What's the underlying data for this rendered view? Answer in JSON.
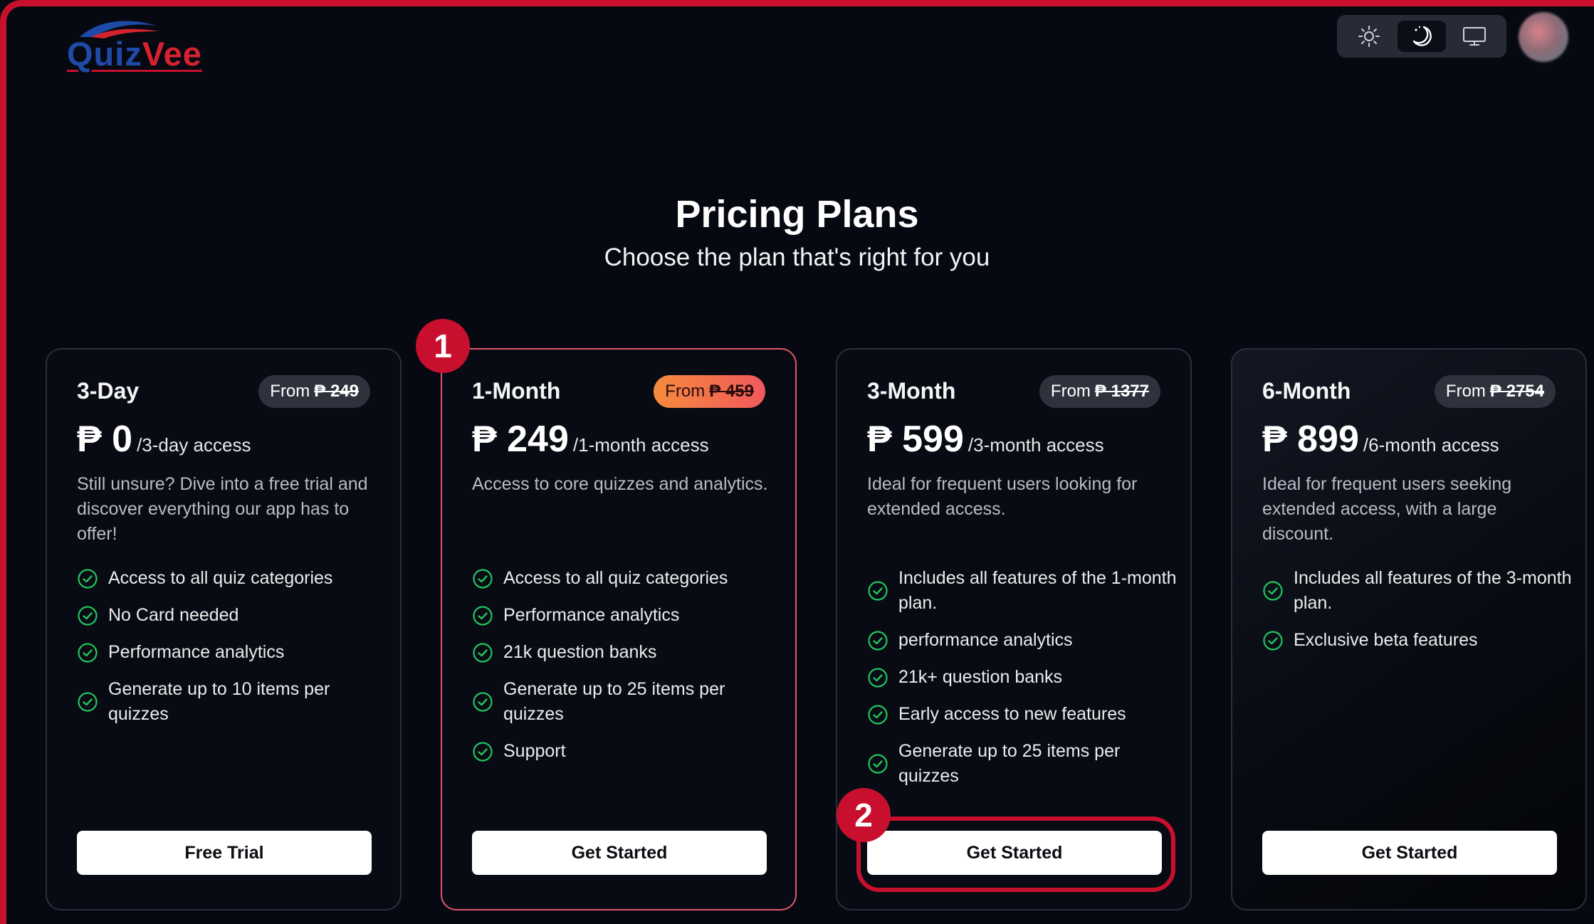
{
  "brand": {
    "name_part1": "Quiz",
    "name_part2": "Vee",
    "primary_color": "#1f4aa8",
    "secondary_color": "#d4232f"
  },
  "header": {
    "theme_options": [
      {
        "icon": "sun-icon",
        "active": false
      },
      {
        "icon": "moon-icon",
        "active": true
      },
      {
        "icon": "monitor-icon",
        "active": false
      }
    ]
  },
  "hero": {
    "title": "Pricing Plans",
    "subtitle": "Choose the plan that's right for you"
  },
  "plans": [
    {
      "name": "3-Day",
      "from_label": "From",
      "old_price": "₱ 249",
      "price": "₱ 0",
      "period": "/3-day access",
      "description": "Still unsure? Dive into a free trial and discover everything our app has to offer!",
      "features": [
        "Access to all quiz categories",
        "No Card needed",
        "Performance analytics",
        "Generate up to 10 items per quizzes"
      ],
      "cta": "Free Trial"
    },
    {
      "name": "1-Month",
      "from_label": "From",
      "old_price": "₱ 459",
      "price": "₱ 249",
      "period": "/1-month access",
      "description": "Access to core quizzes and analytics.",
      "features": [
        "Access to all quiz categories",
        "Performance analytics",
        "21k question banks",
        "Generate up to 25 items per quizzes",
        "Support"
      ],
      "cta": "Get Started"
    },
    {
      "name": "3-Month",
      "from_label": "From",
      "old_price": "₱ 1377",
      "price": "₱ 599",
      "period": "/3-month access",
      "description": "Ideal for frequent users looking for extended access.",
      "features": [
        "Includes all features of the 1-month plan.",
        "performance analytics",
        "21k+ question banks",
        "Early access to new features",
        "Generate up to 25 items per quizzes"
      ],
      "cta": "Get Started"
    },
    {
      "name": "6-Month",
      "from_label": "From",
      "old_price": "₱ 2754",
      "price": "₱ 899",
      "period": "/6-month access",
      "description": "Ideal for frequent users seeking extended access, with a large discount.",
      "features": [
        "Includes all features of the 3-month plan.",
        "Exclusive beta features"
      ],
      "cta": "Get Started"
    }
  ],
  "annotations": {
    "step1": "1",
    "step2": "2",
    "accent_color": "#c8102e"
  }
}
